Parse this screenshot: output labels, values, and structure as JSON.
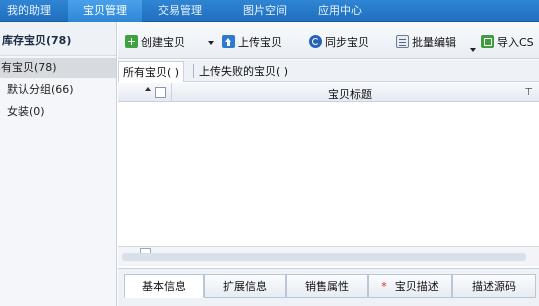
{
  "topnav": {
    "tabs": [
      {
        "label": "我的助理"
      },
      {
        "label": "宝贝管理"
      },
      {
        "label": "交易管理"
      },
      {
        "label": "图片空间"
      },
      {
        "label": "应用中心"
      }
    ],
    "active_index": 1
  },
  "sidebar": {
    "header": "库存宝贝(78)",
    "items": [
      {
        "label": "有宝贝(78)",
        "selected": true
      },
      {
        "label": "默认分组(66)"
      },
      {
        "label": "女装(0)"
      }
    ]
  },
  "toolbar": {
    "create_label": "创建宝贝",
    "upload_label": "上传宝贝",
    "sync_label": "同步宝贝",
    "batch_edit_label": "批量编辑",
    "import_label": "导入CS"
  },
  "subtabs": [
    {
      "label": "所有宝贝(  )"
    },
    {
      "label": "上传失败的宝贝(  )"
    }
  ],
  "table": {
    "column_title": "宝贝标题"
  },
  "bottom_tabs": [
    {
      "label": "基本信息",
      "required": false
    },
    {
      "label": "扩展信息",
      "required": false
    },
    {
      "label": "销售属性",
      "required": false
    },
    {
      "label": "宝贝描述",
      "required": true
    },
    {
      "label": "描述源码",
      "required": false
    }
  ],
  "colors": {
    "nav_bg": "#1f6fbf",
    "nav_active": "#2e87d6",
    "selected_row": "#d7dadf",
    "required_marker": "#e02020"
  },
  "icons": {
    "create": "plus-icon",
    "upload": "upload-arrow-icon",
    "sync": "sync-icon",
    "batch_edit": "edit-list-icon",
    "import": "import-icon",
    "filter": "filter-icon"
  }
}
